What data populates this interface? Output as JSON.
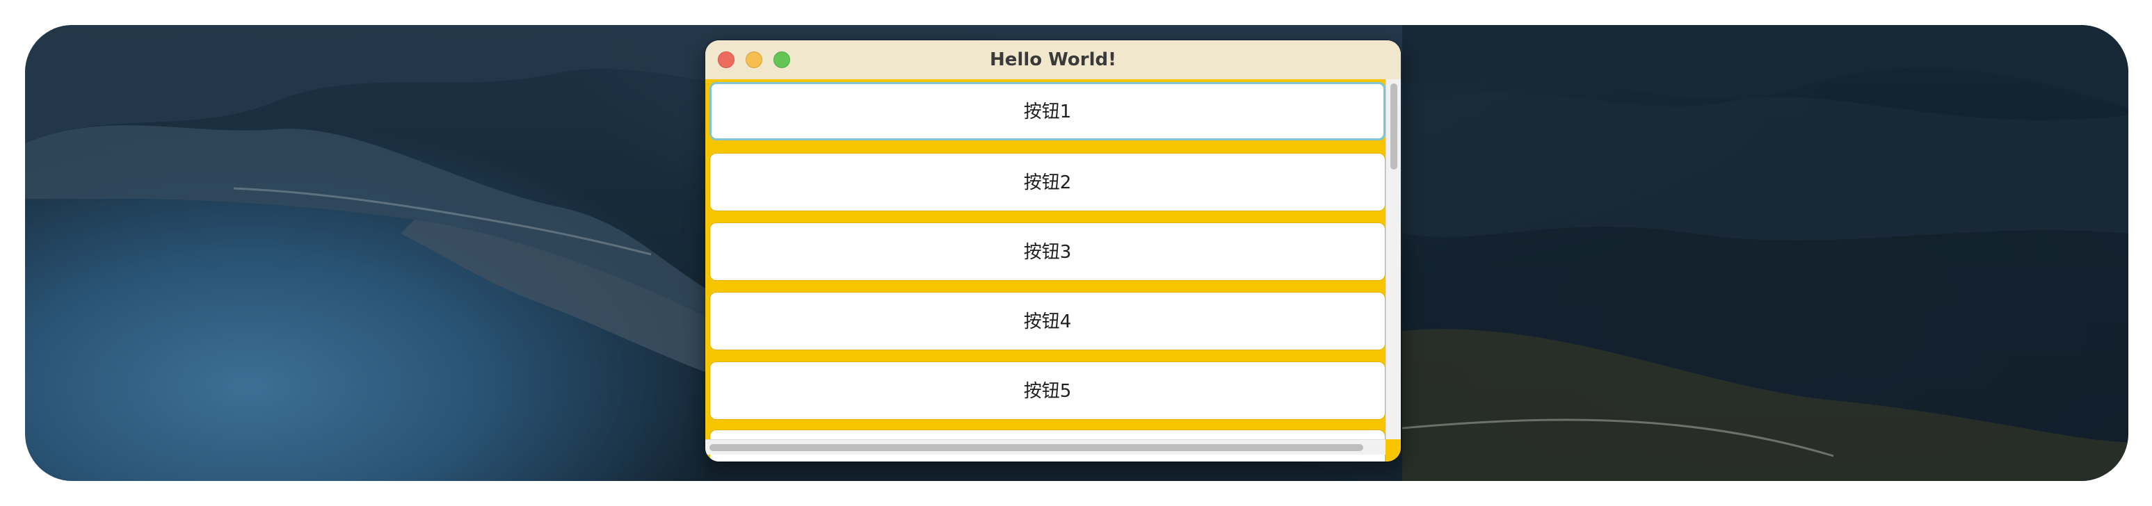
{
  "window": {
    "title": "Hello World!"
  },
  "buttons": [
    {
      "label": "按钮1"
    },
    {
      "label": "按钮2"
    },
    {
      "label": "按钮3"
    },
    {
      "label": "按钮4"
    },
    {
      "label": "按钮5"
    },
    {
      "label": ""
    }
  ],
  "colors": {
    "content_background": "#f7c500",
    "titlebar": "#f0e7cc",
    "focus_ring": "#7fc4d0"
  }
}
